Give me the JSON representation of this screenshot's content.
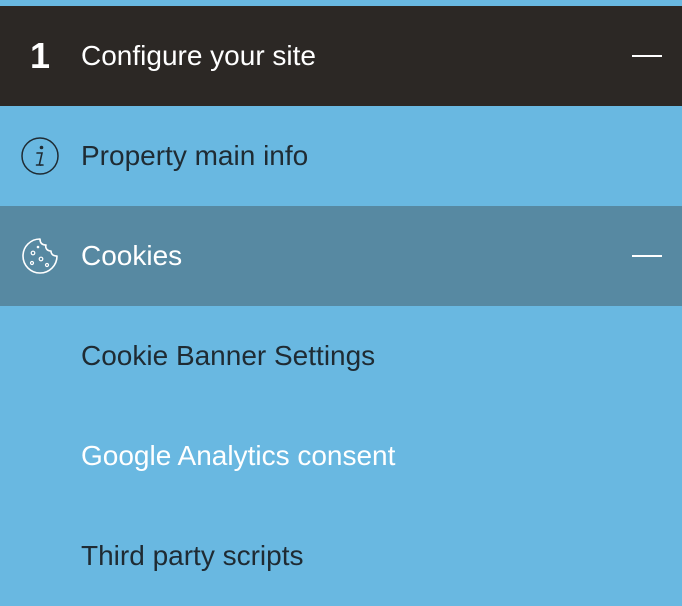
{
  "step": {
    "number": "1",
    "title": "Configure your site"
  },
  "menu": {
    "property_label": "Property main info",
    "cookies_label": "Cookies",
    "sub_items": [
      {
        "label": "Cookie Banner Settings",
        "active": false
      },
      {
        "label": "Google Analytics consent",
        "active": true
      },
      {
        "label": "Third party scripts",
        "active": false
      }
    ]
  },
  "colors": {
    "header_bg": "#2c2825",
    "panel_bg": "#69b8e1",
    "selected_bg": "#5789a2",
    "dark_text": "#1f2b33",
    "light_text": "#ffffff"
  },
  "icons": {
    "collapse": "minus-icon",
    "property": "info-icon",
    "cookies": "cookie-icon"
  }
}
